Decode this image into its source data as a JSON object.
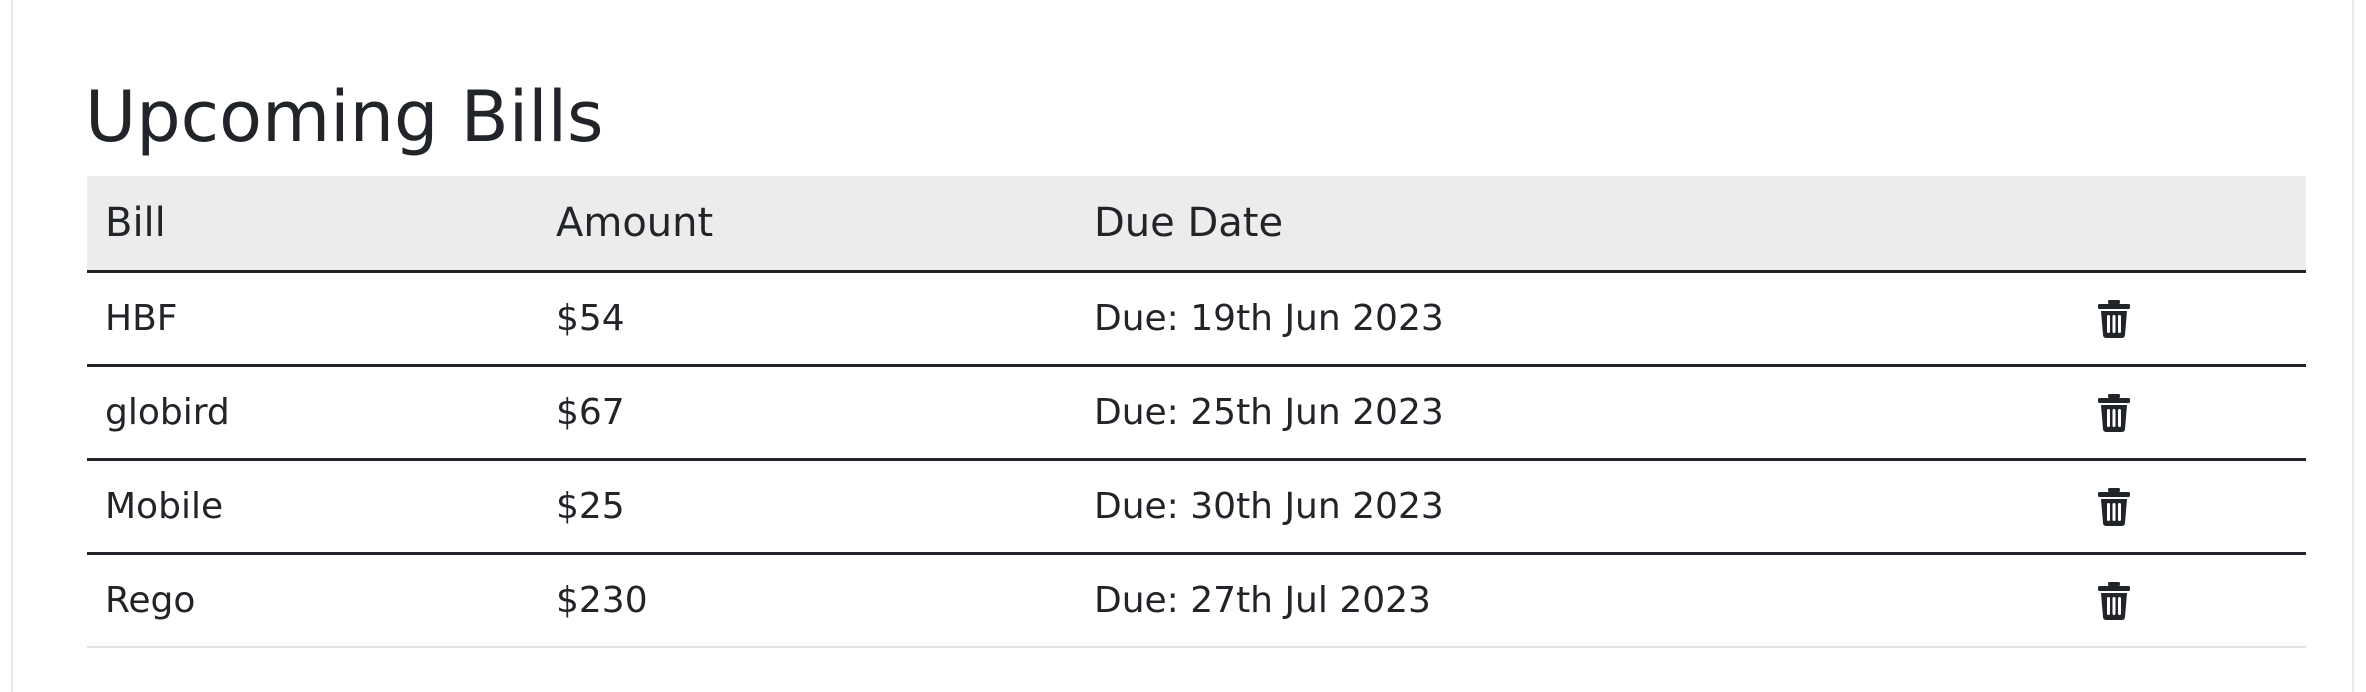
{
  "page": {
    "title": "Upcoming Bills"
  },
  "table": {
    "headers": {
      "bill": "Bill",
      "amount": "Amount",
      "due_date": "Due Date",
      "actions": ""
    },
    "rows": [
      {
        "bill": "HBF",
        "amount": "$54",
        "due": "Due: 19th Jun 2023",
        "action_icon": "trash-icon"
      },
      {
        "bill": "globird",
        "amount": "$67",
        "due": "Due: 25th Jun 2023",
        "action_icon": "trash-icon"
      },
      {
        "bill": "Mobile",
        "amount": "$25",
        "due": "Due: 30th Jun 2023",
        "action_icon": "trash-icon"
      },
      {
        "bill": "Rego",
        "amount": "$230",
        "due": "Due: 27th Jul 2023",
        "action_icon": "trash-icon"
      }
    ]
  },
  "colors": {
    "text": "#212529",
    "header_background": "#ececec",
    "row_divider": "#212529",
    "page_background": "#ffffff"
  }
}
